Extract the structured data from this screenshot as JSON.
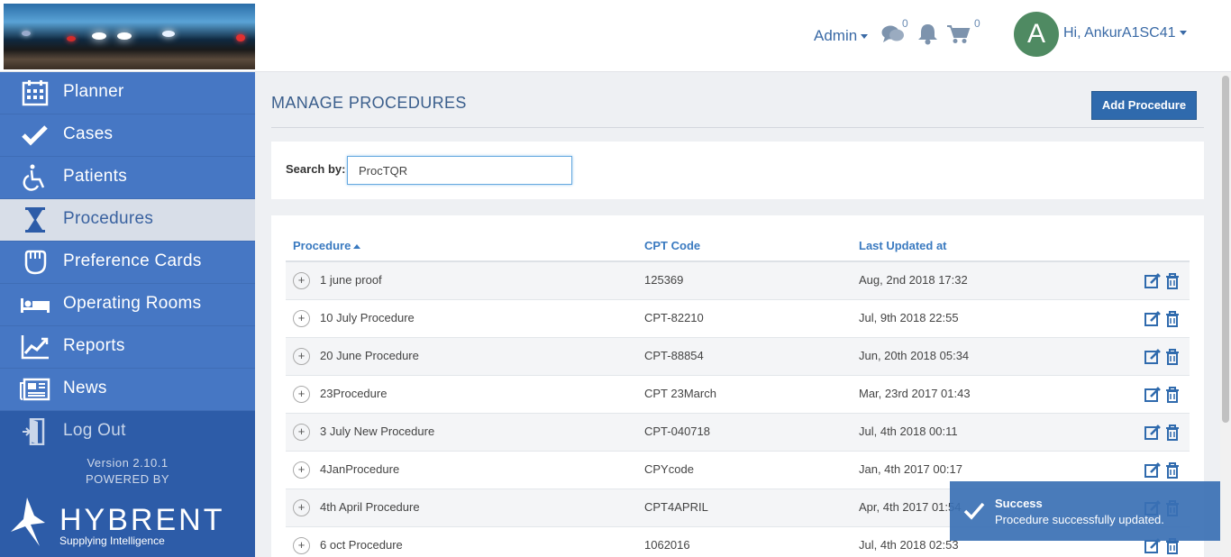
{
  "header": {
    "role_menu": "Admin",
    "messages_count": "0",
    "cart_count": "0",
    "avatar_initial": "A",
    "greeting": "Hi, AnkurA1SC41"
  },
  "sidebar": {
    "items": [
      {
        "label": "Planner",
        "icon": "calendar-icon"
      },
      {
        "label": "Cases",
        "icon": "checkmark-icon"
      },
      {
        "label": "Patients",
        "icon": "wheelchair-icon"
      },
      {
        "label": "Procedures",
        "icon": "hourglass-icon",
        "active": true
      },
      {
        "label": "Preference Cards",
        "icon": "glove-icon"
      },
      {
        "label": "Operating Rooms",
        "icon": "bed-icon"
      },
      {
        "label": "Reports",
        "icon": "chart-icon"
      },
      {
        "label": "News",
        "icon": "newspaper-icon"
      },
      {
        "label": "Log Out",
        "icon": "door-icon"
      }
    ],
    "version": "Version 2.10.1",
    "powered_by": "POWERED BY",
    "brand": "HYBRENT",
    "tagline": "Supplying Intelligence"
  },
  "main": {
    "title": "MANAGE PROCEDURES",
    "add_button": "Add Procedure",
    "search": {
      "label": "Search by:",
      "value": "ProcTQR"
    },
    "table": {
      "columns": [
        "Procedure",
        "CPT Code",
        "Last Updated at"
      ],
      "rows": [
        [
          "1 june proof",
          "125369",
          "Aug, 2nd 2018 17:32"
        ],
        [
          "10 July Procedure",
          "CPT-82210",
          "Jul, 9th 2018 22:55"
        ],
        [
          "20 June Procedure",
          "CPT-88854",
          "Jun, 20th 2018 05:34"
        ],
        [
          "23Procedure",
          "CPT 23March",
          "Mar, 23rd 2017 01:43"
        ],
        [
          "3 July New Procedure",
          "CPT-040718",
          "Jul, 4th 2018 00:11"
        ],
        [
          "4JanProcedure",
          "CPYcode",
          "Jan, 4th 2017 00:17"
        ],
        [
          "4th April Procedure",
          "CPT4APRIL",
          "Apr, 4th 2017 01:54"
        ],
        [
          "6 oct Procedure",
          "1062016",
          "Jul, 4th 2018 02:53"
        ]
      ]
    }
  },
  "toast": {
    "title": "Success",
    "message": "Procedure successfully updated."
  },
  "colors": {
    "sidebar": "#2d5ca8",
    "nav_item": "#4677c4",
    "accent": "#3a7ac0",
    "button": "#2f6aad",
    "toast": "#3a70b4"
  }
}
